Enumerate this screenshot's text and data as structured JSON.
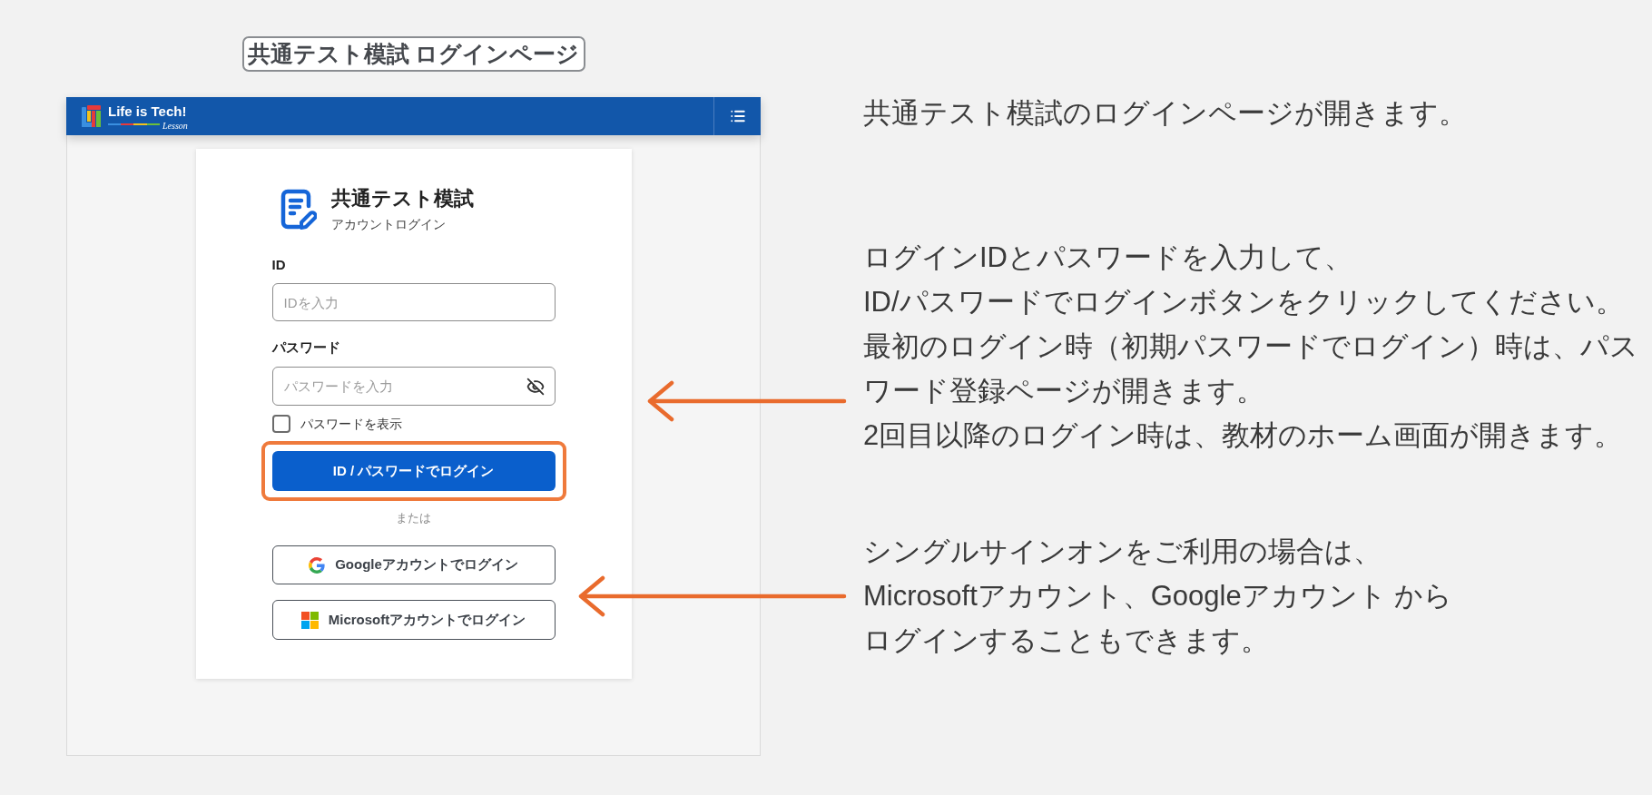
{
  "page_title": "共通テスト模試 ログインページ",
  "app_header": {
    "logo_text": "Life is Tech!",
    "logo_subtext": "Lesson"
  },
  "login_card": {
    "title": "共通テスト模試",
    "subtitle": "アカウントログイン",
    "fields": [
      {
        "label": "ID",
        "placeholder": "IDを入力",
        "kind": "text"
      },
      {
        "label": "パスワード",
        "placeholder": "パスワードを入力",
        "kind": "password"
      }
    ],
    "show_password": {
      "label": "パスワードを表示",
      "checked": false
    },
    "login_button": {
      "label": "ID / パスワードでログイン",
      "highlighted": true
    },
    "separator": "または",
    "sso_buttons": [
      {
        "label": "Googleアカウントでログイン",
        "kind": "google"
      },
      {
        "label": "Microsoftアカウントでログイン",
        "kind": "microsoft"
      }
    ]
  },
  "notes": [
    {
      "lines": [
        "共通テスト模試のログインページが開きます。"
      ]
    },
    {
      "lines": [
        "ログインIDとパスワードを入力して、",
        "ID/パスワードでログインボタンをクリックしてください。",
        "最初のログイン時（初期パスワードでログイン）時は、パス",
        "ワード登録ページが開きます。",
        "2回目以降のログイン時は、教材のホーム画面が開きます。"
      ]
    },
    {
      "lines": [
        "シングルサインオンをご利用の場合は、",
        "Microsoftアカウント、Googleアカウント から",
        "ログインすることもできます。"
      ]
    }
  ]
}
